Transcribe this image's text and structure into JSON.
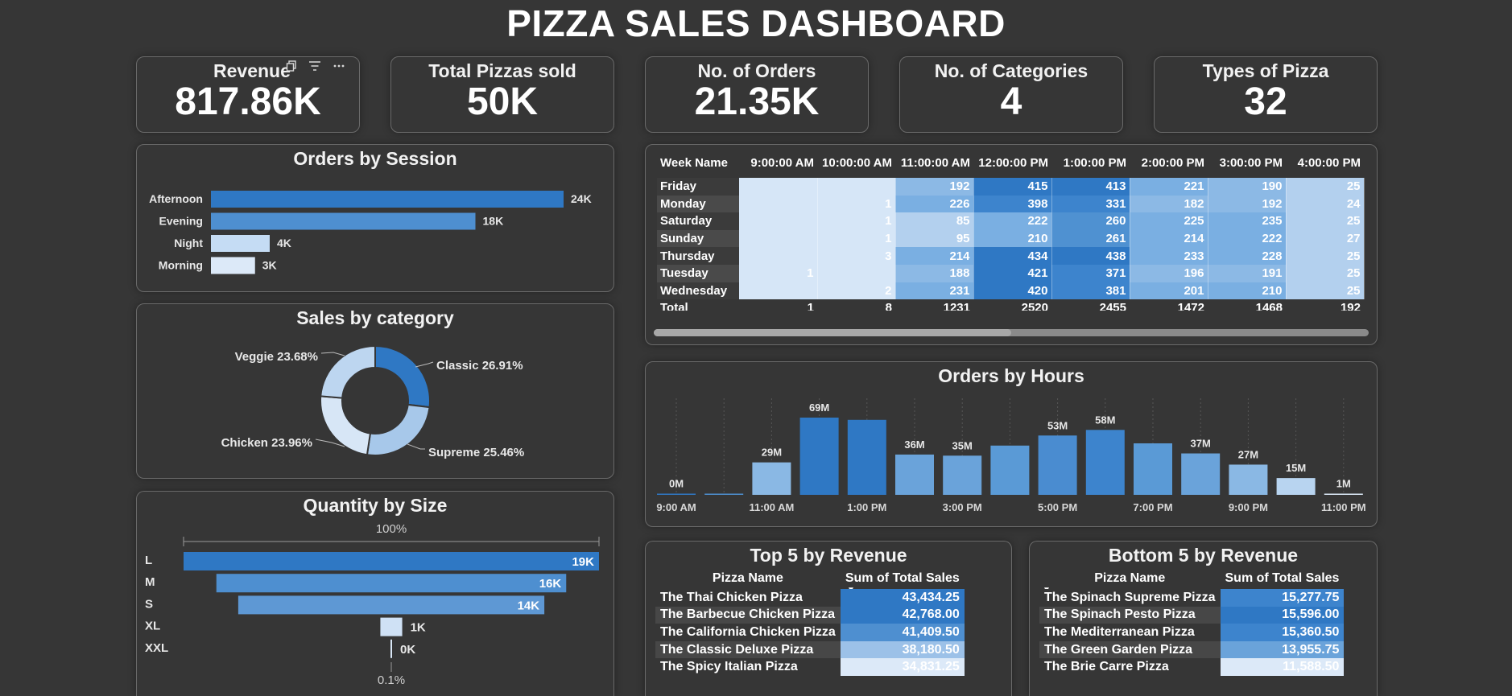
{
  "header": {
    "title": "PIZZA SALES DASHBOARD"
  },
  "kpis": [
    {
      "label": "Revenue",
      "value": "817.86K"
    },
    {
      "label": "Total Pizzas sold",
      "value": "50K"
    },
    {
      "label": "No. of Orders",
      "value": "21.35K"
    },
    {
      "label": "No. of Categories",
      "value": "4"
    },
    {
      "label": "Types of Pizza",
      "value": "32"
    }
  ],
  "card_toolbar": {
    "copy_icon": "copy-icon",
    "filter_icon": "filter-icon",
    "more_icon": "more-options-icon"
  },
  "sessions": {
    "title": "Orders by Session",
    "chart_data": {
      "type": "bar",
      "orientation": "horizontal",
      "categories": [
        "Afternoon",
        "Evening",
        "Night",
        "Morning"
      ],
      "values": [
        24,
        18,
        4,
        3
      ],
      "labels": [
        "24K",
        "18K",
        "4K",
        "3K"
      ],
      "colors": [
        "#2f78c4",
        "#4e8fd0",
        "#c5dcf4",
        "#dce9f8"
      ]
    }
  },
  "category": {
    "title": "Sales by category",
    "chart_data": {
      "type": "pie",
      "donut": true,
      "categories": [
        "Classic",
        "Supreme",
        "Chicken",
        "Veggie"
      ],
      "values": [
        26.91,
        25.46,
        23.96,
        23.68
      ],
      "labels": [
        "Classic 26.91%",
        "Supreme 25.46%",
        "Chicken 23.96%",
        "Veggie 23.68%"
      ],
      "colors": [
        "#2f78c4",
        "#a7c8ea",
        "#d7e6f6",
        "#bdd6f0"
      ]
    }
  },
  "size": {
    "title": "Quantity by Size",
    "top_label": "100%",
    "bottom_label": "0.1%",
    "chart_data": {
      "type": "bar",
      "orientation": "horizontal-centered",
      "categories": [
        "L",
        "M",
        "S",
        "XL",
        "XXL"
      ],
      "values": [
        19,
        16,
        14,
        1,
        0.03
      ],
      "labels": [
        "19K",
        "16K",
        "14K",
        "1K",
        "0K"
      ],
      "colors": [
        "#2f78c4",
        "#4e8fd0",
        "#5e98d4",
        "#cfe1f5",
        "#d9e7f6"
      ]
    }
  },
  "matrix": {
    "columns": [
      "Week Name",
      "9:00:00 AM",
      "10:00:00 AM",
      "11:00:00 AM",
      "12:00:00 PM",
      "1:00:00 PM",
      "2:00:00 PM",
      "3:00:00 PM",
      "4:00:00 PM"
    ],
    "rows": [
      {
        "label": "Friday",
        "cells": [
          "",
          "",
          "192",
          "415",
          "413",
          "221",
          "190",
          "25"
        ]
      },
      {
        "label": "Monday",
        "cells": [
          "",
          "1",
          "226",
          "398",
          "331",
          "182",
          "192",
          "24"
        ]
      },
      {
        "label": "Saturday",
        "cells": [
          "",
          "1",
          "85",
          "222",
          "260",
          "225",
          "235",
          "25"
        ]
      },
      {
        "label": "Sunday",
        "cells": [
          "",
          "1",
          "95",
          "210",
          "261",
          "214",
          "222",
          "27"
        ]
      },
      {
        "label": "Thursday",
        "cells": [
          "",
          "3",
          "214",
          "434",
          "438",
          "233",
          "228",
          "25"
        ]
      },
      {
        "label": "Tuesday",
        "cells": [
          "1",
          "",
          "188",
          "421",
          "371",
          "196",
          "191",
          "25"
        ]
      },
      {
        "label": "Wednesday",
        "cells": [
          "",
          "2",
          "231",
          "420",
          "381",
          "201",
          "210",
          "25"
        ]
      }
    ],
    "total": {
      "label": "Total",
      "cells": [
        "1",
        "8",
        "1231",
        "2520",
        "2455",
        "1472",
        "1468",
        "192"
      ]
    },
    "scroll_fraction": 0.5
  },
  "hours": {
    "title": "Orders by Hours",
    "chart_data": {
      "type": "bar",
      "categories": [
        "9:00 AM",
        "10:00 AM",
        "11:00 AM",
        "12:00 PM",
        "1:00 PM",
        "2:00 PM",
        "3:00 PM",
        "4:00 PM",
        "5:00 PM",
        "6:00 PM",
        "7:00 PM",
        "8:00 PM",
        "9:00 PM",
        "10:00 PM",
        "11:00 PM"
      ],
      "tick_labels": [
        "9:00 AM",
        "",
        "11:00 AM",
        "",
        "1:00 PM",
        "",
        "3:00 PM",
        "",
        "5:00 PM",
        "",
        "7:00 PM",
        "",
        "9:00 PM",
        "",
        "11:00 PM"
      ],
      "values": [
        0.02,
        0.5,
        29,
        69,
        67,
        36,
        35,
        44,
        53,
        58,
        46,
        37,
        27,
        15,
        1
      ],
      "labels": [
        "0M",
        "",
        "29M",
        "69M",
        "",
        "36M",
        "35M",
        "",
        "53M",
        "58M",
        "",
        "37M",
        "27M",
        "15M",
        "1M"
      ],
      "colors": [
        "#2f78c4",
        "#4e8fd0",
        "#8ab8e4",
        "#2f78c4",
        "#2f78c4",
        "#6aa3da",
        "#6aa3da",
        "#5a9ad6",
        "#4a8cd0",
        "#3d84cd",
        "#5a9ad6",
        "#6aa3da",
        "#8ab8e4",
        "#b8d4f0",
        "#dce9f8"
      ]
    }
  },
  "top5": {
    "title": "Top 5 by Revenue",
    "columns": [
      "Pizza Name",
      "Sum of Total Sales"
    ],
    "rows": [
      {
        "name": "The Thai Chicken Pizza",
        "value": "43,434.25",
        "color": "#2f78c4"
      },
      {
        "name": "The Barbecue Chicken Pizza",
        "value": "42,768.00",
        "color": "#2f78c4"
      },
      {
        "name": "The California Chicken Pizza",
        "value": "41,409.50",
        "color": "#4e8fd0"
      },
      {
        "name": "The Classic Deluxe Pizza",
        "value": "38,180.50",
        "color": "#9cc1e8"
      },
      {
        "name": "The Spicy Italian Pizza",
        "value": "34,831.25",
        "color": "#dce9f8"
      }
    ]
  },
  "bottom5": {
    "title": "Bottom 5 by Revenue",
    "columns": [
      "Pizza Name",
      "Sum of Total Sales"
    ],
    "rows": [
      {
        "name": "The Spinach Supreme Pizza",
        "value": "15,277.75",
        "color": "#3d84cd"
      },
      {
        "name": "The Spinach Pesto Pizza",
        "value": "15,596.00",
        "color": "#2f78c4"
      },
      {
        "name": "The Mediterranean Pizza",
        "value": "15,360.50",
        "color": "#3d84cd"
      },
      {
        "name": "The Green Garden Pizza",
        "value": "13,955.75",
        "color": "#6aa3da"
      },
      {
        "name": "The Brie Carre Pizza",
        "value": "11,588.50",
        "color": "#dce9f8"
      }
    ]
  }
}
